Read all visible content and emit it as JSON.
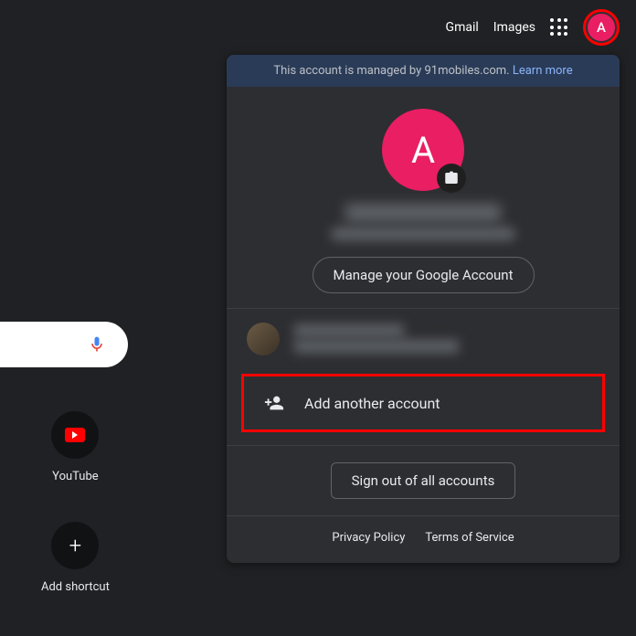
{
  "topbar": {
    "gmail_label": "Gmail",
    "images_label": "Images",
    "avatar_letter": "A"
  },
  "account_panel": {
    "managed_text": "This account is managed by 91mobiles.com. ",
    "learn_more": "Learn more",
    "big_avatar_letter": "A",
    "manage_button": "Manage your Google Account",
    "add_account": "Add another account",
    "signout": "Sign out of all accounts",
    "footer": {
      "privacy": "Privacy Policy",
      "terms": "Terms of Service"
    }
  },
  "shortcuts": {
    "youtube": "YouTube",
    "add_shortcut": "Add shortcut"
  },
  "colors": {
    "accent_pink": "#e91e63",
    "highlight_red": "#ff0000",
    "link_blue": "#8ab4f8",
    "background": "#202124"
  }
}
